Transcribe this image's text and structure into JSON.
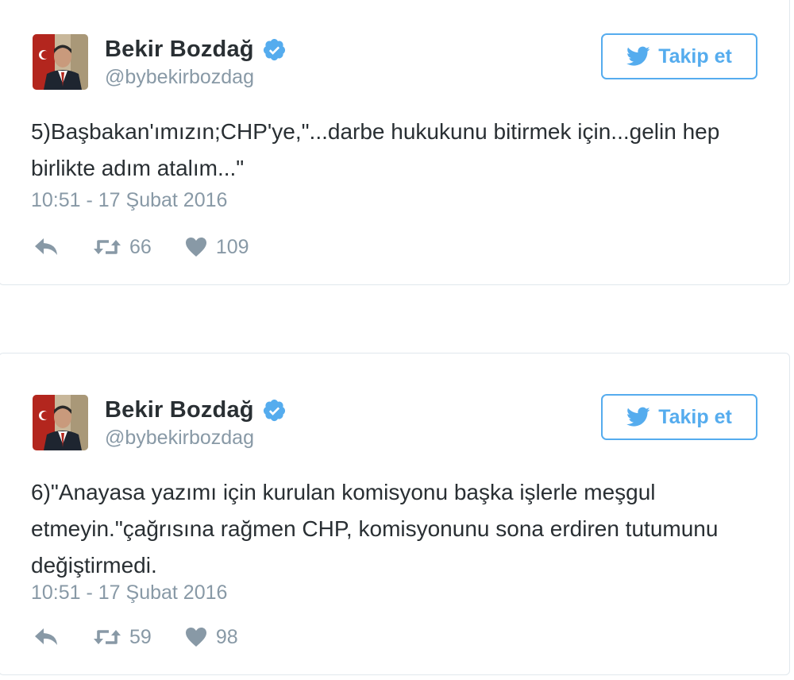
{
  "colors": {
    "accent": "#55acee",
    "text": "#292f33",
    "muted": "#8899a6",
    "border": "#e1e8ed"
  },
  "tweets": [
    {
      "author_name": "Bekir Bozdağ",
      "handle": "@bybekirbozdag",
      "verified": true,
      "follow_label": "Takip et",
      "text": "5)Başbakan'ımızın;CHP'ye,\"...darbe hukukunu bitirmek için...gelin hep birlikte adım atalım...\"",
      "timestamp": "10:51 - 17 Şubat 2016",
      "retweets": "66",
      "likes": "109",
      "icons": [
        "verified-badge-icon",
        "twitter-bird-icon",
        "reply-icon",
        "retweet-icon",
        "heart-icon"
      ]
    },
    {
      "author_name": "Bekir Bozdağ",
      "handle": "@bybekirbozdag",
      "verified": true,
      "follow_label": "Takip et",
      "text": "6)\"Anayasa yazımı için kurulan komisyonu başka işlerle meşgul etmeyin.\"çağrısına rağmen CHP, komisyonunu sona erdiren tutumunu değiştirmedi.",
      "timestamp": "10:51 - 17 Şubat 2016",
      "retweets": "59",
      "likes": "98",
      "icons": [
        "verified-badge-icon",
        "twitter-bird-icon",
        "reply-icon",
        "retweet-icon",
        "heart-icon"
      ]
    }
  ]
}
